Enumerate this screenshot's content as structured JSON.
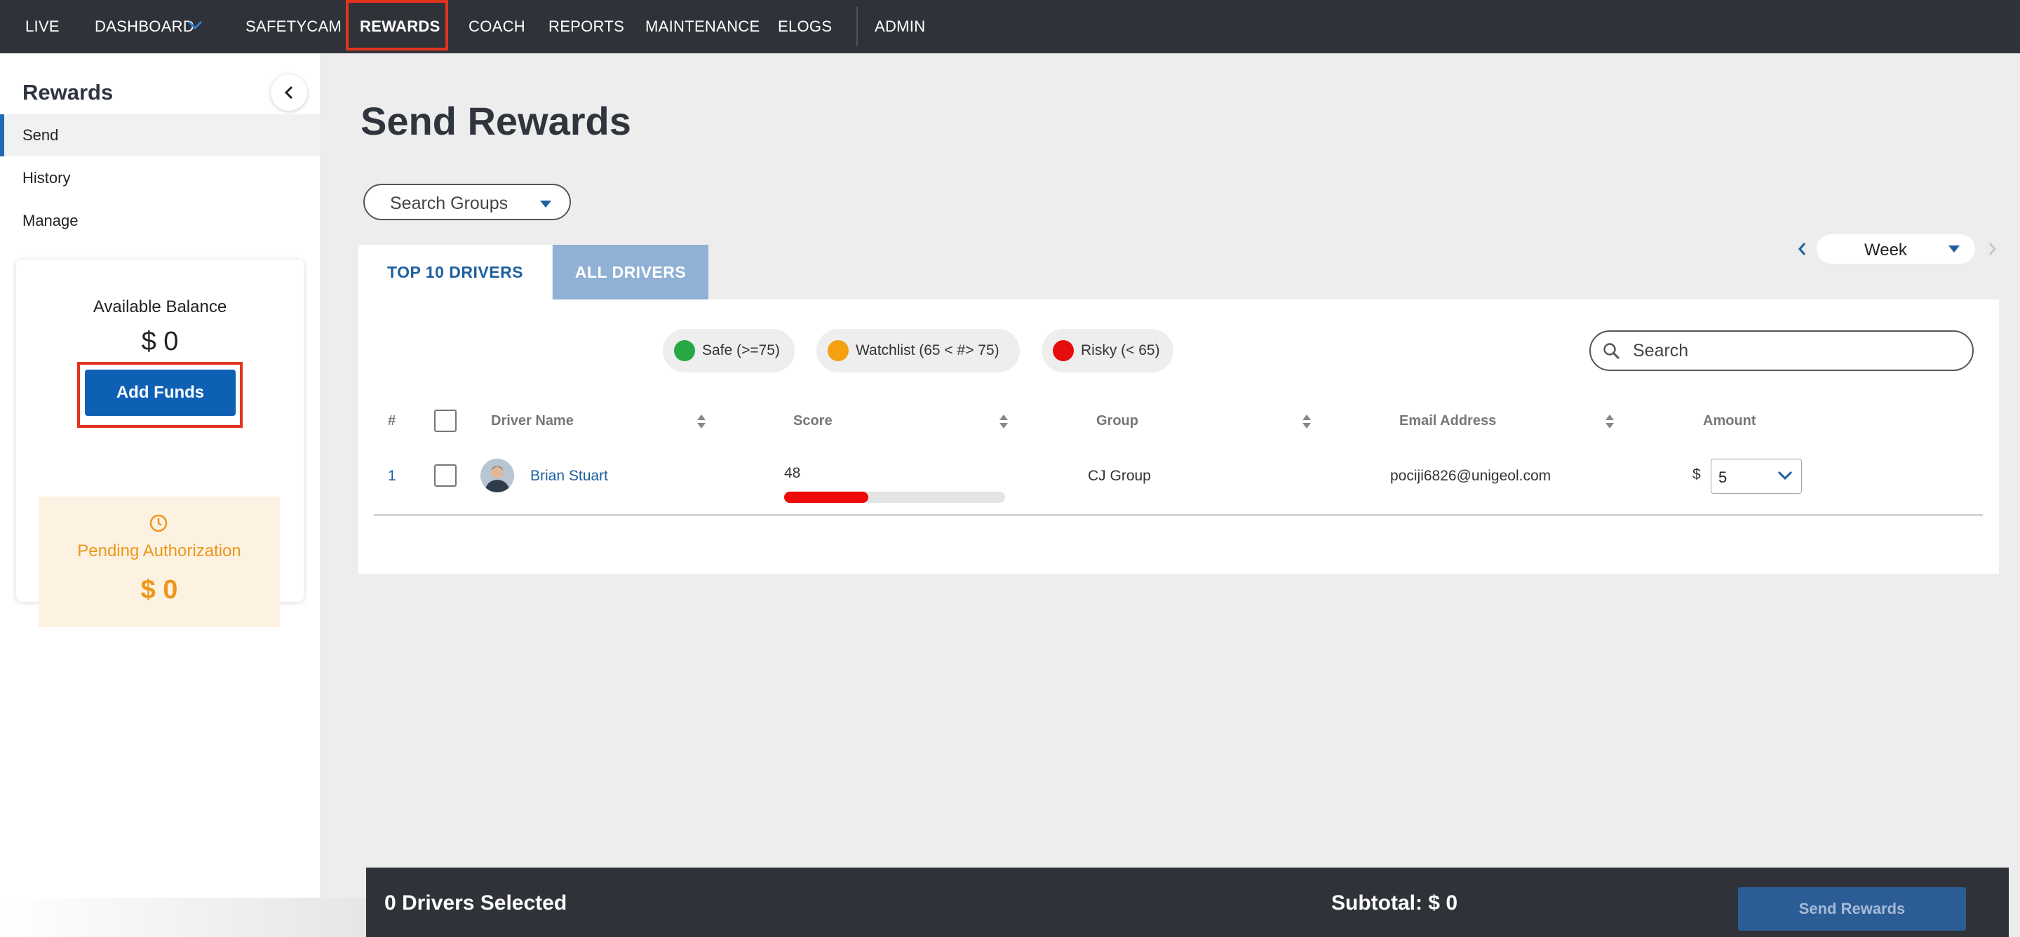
{
  "nav": {
    "items": [
      "LIVE",
      "DASHBOARD",
      "SAFETYCAM",
      "REWARDS",
      "COACH",
      "REPORTS",
      "MAINTENANCE",
      "ELOGS",
      "ADMIN"
    ],
    "active": "REWARDS"
  },
  "sidebar": {
    "title": "Rewards",
    "items": [
      "Send",
      "History",
      "Manage"
    ],
    "active": "Send",
    "balance": {
      "label": "Available Balance",
      "value": "$ 0",
      "add_funds": "Add Funds",
      "pending_label": "Pending Authorization",
      "pending_value": "$ 0"
    }
  },
  "main": {
    "title": "Send Rewards",
    "group_select": "Search Groups",
    "tabs": [
      "TOP 10 DRIVERS",
      "ALL DRIVERS"
    ],
    "active_tab": "TOP 10 DRIVERS",
    "period": "Week",
    "legend": [
      {
        "label": "Safe (>=75)",
        "color": "#27a843"
      },
      {
        "label": "Watchlist (65 < #> 75)",
        "color": "#f5a00f"
      },
      {
        "label": "Risky (< 65)",
        "color": "#e80d0d"
      }
    ],
    "search_placeholder": "Search",
    "columns": [
      "#",
      "Driver Name",
      "Score",
      "Group",
      "Email Address",
      "Amount"
    ],
    "rows": [
      {
        "index": "1",
        "name": "Brian Stuart",
        "score": "48",
        "score_fraction": 0.38,
        "group": "CJ Group",
        "email": "pociji6826@unigeol.com",
        "currency": "$",
        "amount": "5"
      }
    ]
  },
  "footer": {
    "selected": "0 Drivers Selected",
    "subtotal": "Subtotal: $ 0",
    "send": "Send Rewards"
  },
  "colors": {
    "nav_bg": "#2f3339",
    "accent": "#0e60b5",
    "highlight": "#e2331f",
    "pending": "#ec961a"
  }
}
